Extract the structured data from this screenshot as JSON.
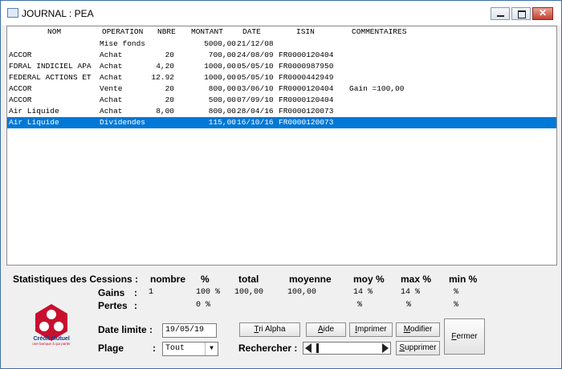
{
  "window": {
    "title": "JOURNAL : PEA"
  },
  "table": {
    "headers": {
      "nom": "NOM",
      "operation": "OPERATION",
      "nbre": "NBRE",
      "montant": "MONTANT",
      "date": "DATE",
      "isin": "ISIN",
      "commentaires": "COMMENTAIRES"
    },
    "rows": [
      {
        "nom": "",
        "operation": "Mise fonds",
        "nbre": "",
        "montant": "5000,00",
        "date": "21/12/08",
        "isin": "",
        "comm": ""
      },
      {
        "nom": "ACCOR",
        "operation": "Achat",
        "nbre": "20",
        "montant": "700,00",
        "date": "24/08/09",
        "isin": "FR0000120404",
        "comm": ""
      },
      {
        "nom": "FDRAL INDICIEL APA",
        "operation": "Achat",
        "nbre": "4,20",
        "montant": "1000,00",
        "date": "05/05/10",
        "isin": "FR0000987950",
        "comm": ""
      },
      {
        "nom": "FEDERAL ACTIONS ET",
        "operation": "Achat",
        "nbre": "12.92",
        "montant": "1000,00",
        "date": "05/05/10",
        "isin": "FR0000442949",
        "comm": ""
      },
      {
        "nom": "ACCOR",
        "operation": "Vente",
        "nbre": "20",
        "montant": "800,00",
        "date": "03/06/10",
        "isin": "FR0000120404",
        "comm": "Gain =100,00"
      },
      {
        "nom": "ACCOR",
        "operation": "Achat",
        "nbre": "20",
        "montant": "500,00",
        "date": "07/09/10",
        "isin": "FR0000120404",
        "comm": ""
      },
      {
        "nom": "Air Liquide",
        "operation": "Achat",
        "nbre": "8,00",
        "montant": "800,00",
        "date": "28/04/16",
        "isin": "FR0000120073",
        "comm": ""
      },
      {
        "nom": "Air Liquide",
        "operation": "Dividendes",
        "nbre": "",
        "montant": "115,00",
        "date": "16/10/16",
        "isin": "FR0000120073",
        "comm": ""
      }
    ]
  },
  "stats": {
    "title": "Statistiques des Cessions :",
    "headers": {
      "nombre": "nombre",
      "pct": "%",
      "total": "total",
      "moyenne": "moyenne",
      "moy": "moy %",
      "max": "max %",
      "min": "min %"
    },
    "gains": {
      "label": "Gains",
      "colon": ":",
      "nombre": "1",
      "pct": "100 %",
      "total": "100,00",
      "moyenne": "100,00",
      "moy": "14 %",
      "max": "14 %",
      "min": "%"
    },
    "pertes": {
      "label": "Pertes",
      "colon": ":",
      "pct": "0 %",
      "moy": "%",
      "max": "%",
      "min": "%"
    }
  },
  "logo": {
    "name": "Crédit Mutuel",
    "tagline": "une banque à qui parler"
  },
  "form": {
    "date_label": "Date limite :",
    "date_value": "19/05/19",
    "plage_label": "Plage",
    "plage_colon": ":",
    "plage_value": "Tout",
    "search_label": "Rechercher :"
  },
  "buttons": {
    "tri_first": "T",
    "tri_rest": "ri Alpha",
    "aide_first": "A",
    "aide_rest": "ide",
    "imprimer_first": "I",
    "imprimer_rest": "mprimer",
    "modifier_first": "M",
    "modifier_rest": "odifier",
    "supprimer_first": "S",
    "supprimer_rest": "upprimer",
    "fermer_first": "F",
    "fermer_rest": "ermer"
  },
  "colors": {
    "selection": "#0078d7",
    "accent": "#c8102e",
    "logo_blue": "#1a3d8f"
  }
}
